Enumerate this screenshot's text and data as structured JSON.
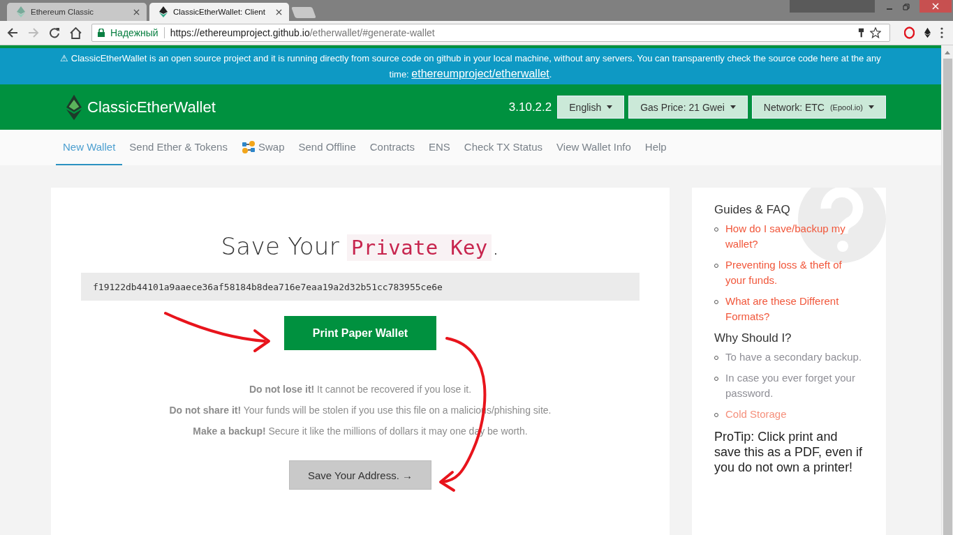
{
  "browser": {
    "tabs": [
      {
        "title": "Ethereum Classic",
        "selected": false
      },
      {
        "title": "ClassicEtherWallet: Client",
        "selected": true
      }
    ],
    "security_label": "Надежный",
    "url_origin": "https://ethereumproject.github.io",
    "url_path": "/etherwallet/#generate-wallet"
  },
  "banner": {
    "text": "⚠ ClassicEtherWallet is an open source project and it is running directly from source code on github in your local machine, without any servers. You can transparently check the source code here at the any time:",
    "link": "ethereumproject/etherwallet",
    "end": "."
  },
  "header": {
    "brand": "ClassicEtherWallet",
    "version": "3.10.2.2",
    "dropdowns": [
      {
        "label": "English"
      },
      {
        "label": "Gas Price: 21 Gwei"
      },
      {
        "label": "Network: ETC",
        "note": "(Epool.io)"
      }
    ]
  },
  "nav": [
    {
      "label": "New Wallet",
      "kind": "plain",
      "selected": true
    },
    {
      "label": "Send Ether & Tokens",
      "kind": "plain",
      "selected": false
    },
    {
      "label": "Swap",
      "kind": "swap",
      "selected": false
    },
    {
      "label": "Send Offline",
      "kind": "plain",
      "selected": false
    },
    {
      "label": "Contracts",
      "kind": "plain",
      "selected": false
    },
    {
      "label": "ENS",
      "kind": "plain",
      "selected": false
    },
    {
      "label": "Check TX Status",
      "kind": "plain",
      "selected": false
    },
    {
      "label": "View Wallet Info",
      "kind": "plain",
      "selected": false
    },
    {
      "label": "Help",
      "kind": "plain",
      "selected": false
    }
  ],
  "main": {
    "heading": "Save Your",
    "heading_code": "Private Key",
    "heading_end": ".",
    "private_key": "f19122db44101a9aaece36af58184b8dea716e7eaa19a2d32b51cc783955ce6e",
    "print_button": "Print Paper Wallet",
    "warnings": [
      "**Do not lose it!** It cannot be recovered if you lose it.",
      "**Do not share it!** Your funds will be stolen if you use this file on a malicious/phishing site.",
      "**Make a backup!** Secure it like the millions of dollars it may one day be worth."
    ],
    "next_button": "Save Your Address. →"
  },
  "sidebar": {
    "sections": [
      {
        "title": "Guides & FAQ",
        "items": [
          {
            "text": "How do I save/backup my wallet?",
            "kind": "link"
          },
          {
            "text": "Preventing loss & theft of your funds.",
            "kind": "link"
          },
          {
            "text": "What are these Different Formats?",
            "kind": "link"
          }
        ]
      },
      {
        "title": "Why Should I?",
        "items": [
          {
            "text": "To have a secondary backup.",
            "kind": "text"
          },
          {
            "text": "In case you ever forget your password.",
            "kind": "text"
          },
          {
            "text": "Cold Storage",
            "kind": "faint-link"
          }
        ]
      }
    ],
    "protip": "ProTip: Click print and save this as a PDF, even if you do not own a printer!"
  }
}
